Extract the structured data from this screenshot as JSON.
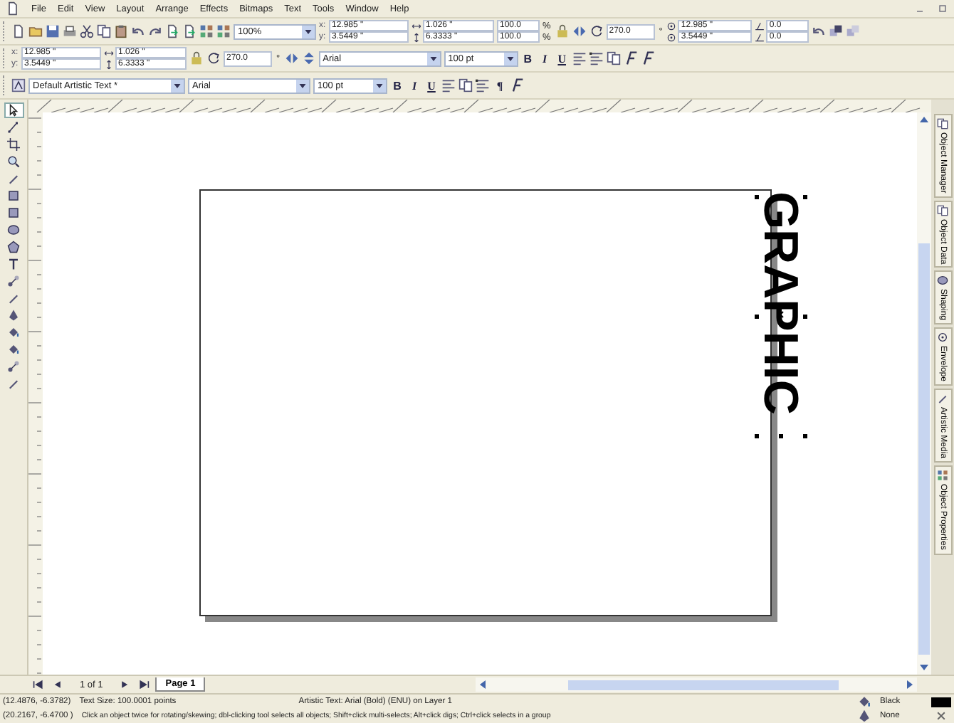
{
  "menu": [
    "File",
    "Edit",
    "View",
    "Layout",
    "Arrange",
    "Effects",
    "Bitmaps",
    "Text",
    "Tools",
    "Window",
    "Help"
  ],
  "toolbars": [
    [
      {
        "kind": "new"
      },
      {
        "kind": "open"
      },
      {
        "kind": "save"
      },
      {
        "kind": "print"
      },
      {
        "kind": "cut"
      },
      {
        "kind": "copy"
      },
      {
        "kind": "paste"
      },
      {
        "kind": "undo"
      },
      {
        "kind": "redo"
      },
      {
        "kind": "import"
      },
      {
        "kind": "export"
      },
      {
        "kind": "launcher"
      },
      {
        "kind": "grid"
      },
      {
        "kind": "zoom",
        "value": "100%"
      },
      {
        "kind": "position",
        "labels": [
          "x:",
          "y:"
        ],
        "values": [
          "12.985 \"",
          "3.5449 \""
        ]
      },
      {
        "kind": "size",
        "values": [
          "1.026 \"",
          "6.3333 \""
        ]
      },
      {
        "kind": "scale",
        "values": [
          "100.0",
          "100.0"
        ],
        "units": [
          "%",
          "%"
        ]
      },
      {
        "kind": "lock"
      },
      {
        "kind": "mirror"
      },
      {
        "kind": "angle",
        "value": "270.0",
        "unit": "°"
      },
      {
        "kind": "center",
        "values": [
          "12.985 \"",
          "3.5449 \""
        ]
      },
      {
        "kind": "offset",
        "values": [
          "0.0",
          "0.0"
        ]
      },
      {
        "kind": "spin"
      },
      {
        "kind": "front"
      },
      {
        "kind": "back"
      }
    ],
    [
      {
        "kind": "position",
        "labels": [
          "x:",
          "y:"
        ],
        "values": [
          "12.985 \"",
          "3.5449 \""
        ]
      },
      {
        "kind": "size",
        "values": [
          "1.026 \"",
          "6.3333 \""
        ]
      },
      {
        "kind": "lock"
      },
      {
        "kind": "angle",
        "value": "270.0",
        "unit": "°"
      },
      {
        "kind": "mirror"
      },
      {
        "kind": "flip"
      },
      {
        "kind": "font",
        "value": "Arial"
      },
      {
        "kind": "fontsize",
        "value": "100 pt"
      },
      {
        "kind": "bold",
        "label": "B"
      },
      {
        "kind": "italic",
        "label": "I"
      },
      {
        "kind": "underline",
        "label": "U"
      },
      {
        "kind": "align"
      },
      {
        "kind": "bullets"
      },
      {
        "kind": "columns"
      },
      {
        "kind": "format"
      },
      {
        "kind": "edittext"
      }
    ],
    [
      {
        "kind": "textstyle"
      },
      {
        "kind": "preset",
        "value": "Default Artistic Text *"
      },
      {
        "kind": "font",
        "value": "Arial"
      },
      {
        "kind": "fontsize",
        "value": "100 pt"
      },
      {
        "kind": "bold",
        "label": "B"
      },
      {
        "kind": "italic",
        "label": "I"
      },
      {
        "kind": "underline",
        "label": "U"
      },
      {
        "kind": "align"
      },
      {
        "kind": "columns"
      },
      {
        "kind": "bullets"
      },
      {
        "kind": "paragraph",
        "label": "¶"
      },
      {
        "kind": "format"
      }
    ]
  ],
  "toolbox": [
    {
      "kind": "pick",
      "selected": true
    },
    {
      "kind": "shape",
      "selected": false
    },
    {
      "kind": "crop",
      "selected": false
    },
    {
      "kind": "zoom",
      "selected": false
    },
    {
      "kind": "freehand",
      "selected": false
    },
    {
      "kind": "smart",
      "selected": false
    },
    {
      "kind": "rectangle",
      "selected": false
    },
    {
      "kind": "ellipse",
      "selected": false
    },
    {
      "kind": "polygon",
      "selected": false
    },
    {
      "kind": "text",
      "selected": false
    },
    {
      "kind": "blend",
      "selected": false
    },
    {
      "kind": "eyedropper",
      "selected": false
    },
    {
      "kind": "outline",
      "selected": false
    },
    {
      "kind": "fill",
      "selected": false
    },
    {
      "kind": "interactive_fill",
      "selected": false
    },
    {
      "kind": "connector",
      "selected": false
    },
    {
      "kind": "knife",
      "selected": false
    }
  ],
  "canvas": {
    "artistic_text": "GRAPHIC",
    "selected": true
  },
  "dockers": [
    "Object Manager",
    "Object Data",
    "Shaping",
    "Envelope",
    "Artistic Media",
    "Object Properties"
  ],
  "page_nav": {
    "count": "1 of 1",
    "tabs": [
      {
        "label": "Page 1",
        "selected": true
      }
    ]
  },
  "status_bar": {
    "cursor": "(12.4876, -6.3782)",
    "text_size": "Text Size: 100.0001 points",
    "object": "Artistic Text: Arial (Bold) (ENU) on Layer 1",
    "fill": {
      "name": "Black",
      "color": "#000000"
    },
    "cursor2": "(20.2167, -6.4700 )",
    "hint": "Click an object twice for rotating/skewing; dbl-clicking tool selects all objects; Shift+click multi-selects; Alt+click digs; Ctrl+click selects in a group",
    "outline": "None"
  }
}
